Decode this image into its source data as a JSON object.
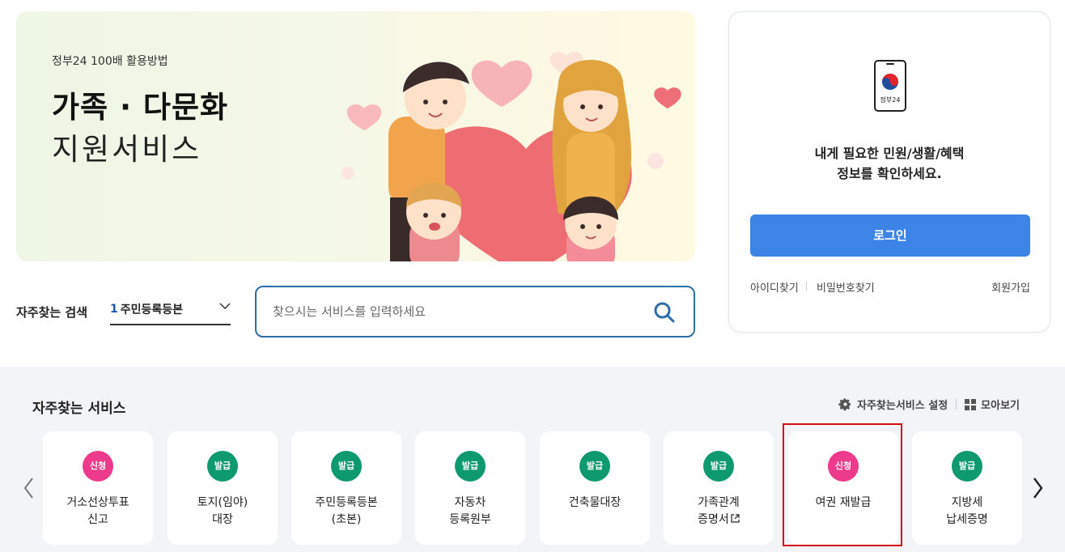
{
  "banner": {
    "kicker": "정부24 100배 활용방법",
    "title_line1": "가족 · 다문화",
    "title_line2": "지원서비스"
  },
  "search": {
    "label": "자주찾는 검색",
    "select_rank": "1",
    "select_value": "주민등록등본",
    "placeholder": "찾으시는 서비스를 입력하세요",
    "icon": "search-icon"
  },
  "login": {
    "app_label": "정부24",
    "message_line1": "내게 필요한 민원/생활/혜택",
    "message_line2": "정보를 확인하세요.",
    "login_label": "로그인",
    "find_id": "아이디찾기",
    "find_password": "비밀번호찾기",
    "signup": "회원가입"
  },
  "services": {
    "title": "자주찾는 서비스",
    "settings_label": "자주찾는서비스 설정",
    "view_all_label": "모아보기",
    "colors": {
      "apply": "#ee3a8c",
      "issue": "#0e9a6e"
    },
    "items": [
      {
        "badge": "신청",
        "type": "apply",
        "line1": "거소선상투표",
        "line2": "신고"
      },
      {
        "badge": "발급",
        "type": "issue",
        "line1": "토지(임야)",
        "line2": "대장"
      },
      {
        "badge": "발급",
        "type": "issue",
        "line1": "주민등록등본",
        "line2": "(초본)"
      },
      {
        "badge": "발급",
        "type": "issue",
        "line1": "자동차",
        "line2": "등록원부"
      },
      {
        "badge": "발급",
        "type": "issue",
        "line1": "건축물대장",
        "line2": ""
      },
      {
        "badge": "발급",
        "type": "issue",
        "line1": "가족관계",
        "line2": "증명서"
      },
      {
        "badge": "신청",
        "type": "apply",
        "line1": "여권 재발급",
        "line2": ""
      },
      {
        "badge": "발급",
        "type": "issue",
        "line1": "지방세",
        "line2": "납세증명"
      }
    ]
  }
}
